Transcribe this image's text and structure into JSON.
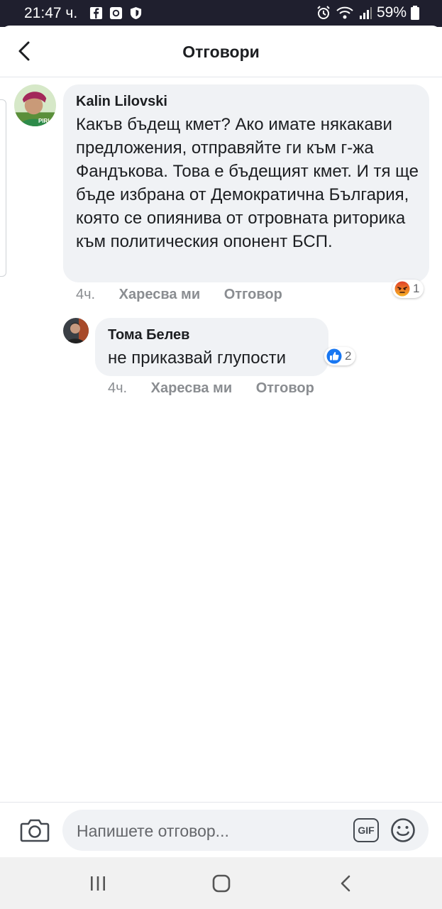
{
  "status_bar": {
    "time": "21:47 ч.",
    "battery": "59%"
  },
  "header": {
    "title": "Отговори"
  },
  "comments": [
    {
      "author": "Kalin Lilovski",
      "avatar_tag": "PIRI",
      "text": "Какъв бъдещ кмет? Ако имате някакави предложения, отправяйте ги към г-жа Фандъкова. Това е бъдещият кмет. И тя ще бъде избрана от Демократична България, която се опиянива от отровната риторика към политическия опонент БСП.",
      "time": "4ч.",
      "like_label": "Харесва ми",
      "reply_label": "Отговор",
      "reaction_type": "angry",
      "reaction_count": "1"
    },
    {
      "author": "Тома Белев",
      "text": "не приказвай глупости",
      "time": "4ч.",
      "like_label": "Харесва ми",
      "reply_label": "Отговор",
      "reaction_type": "like",
      "reaction_count": "2"
    }
  ],
  "composer": {
    "placeholder": "Напишете отговор...",
    "gif_label": "GIF"
  },
  "colors": {
    "bubble": "#f0f2f5",
    "meta_text": "#8a8d91",
    "like_blue": "#1877f2",
    "angry_orange": "#f0622d",
    "status_bar": "#1f1f2e"
  }
}
